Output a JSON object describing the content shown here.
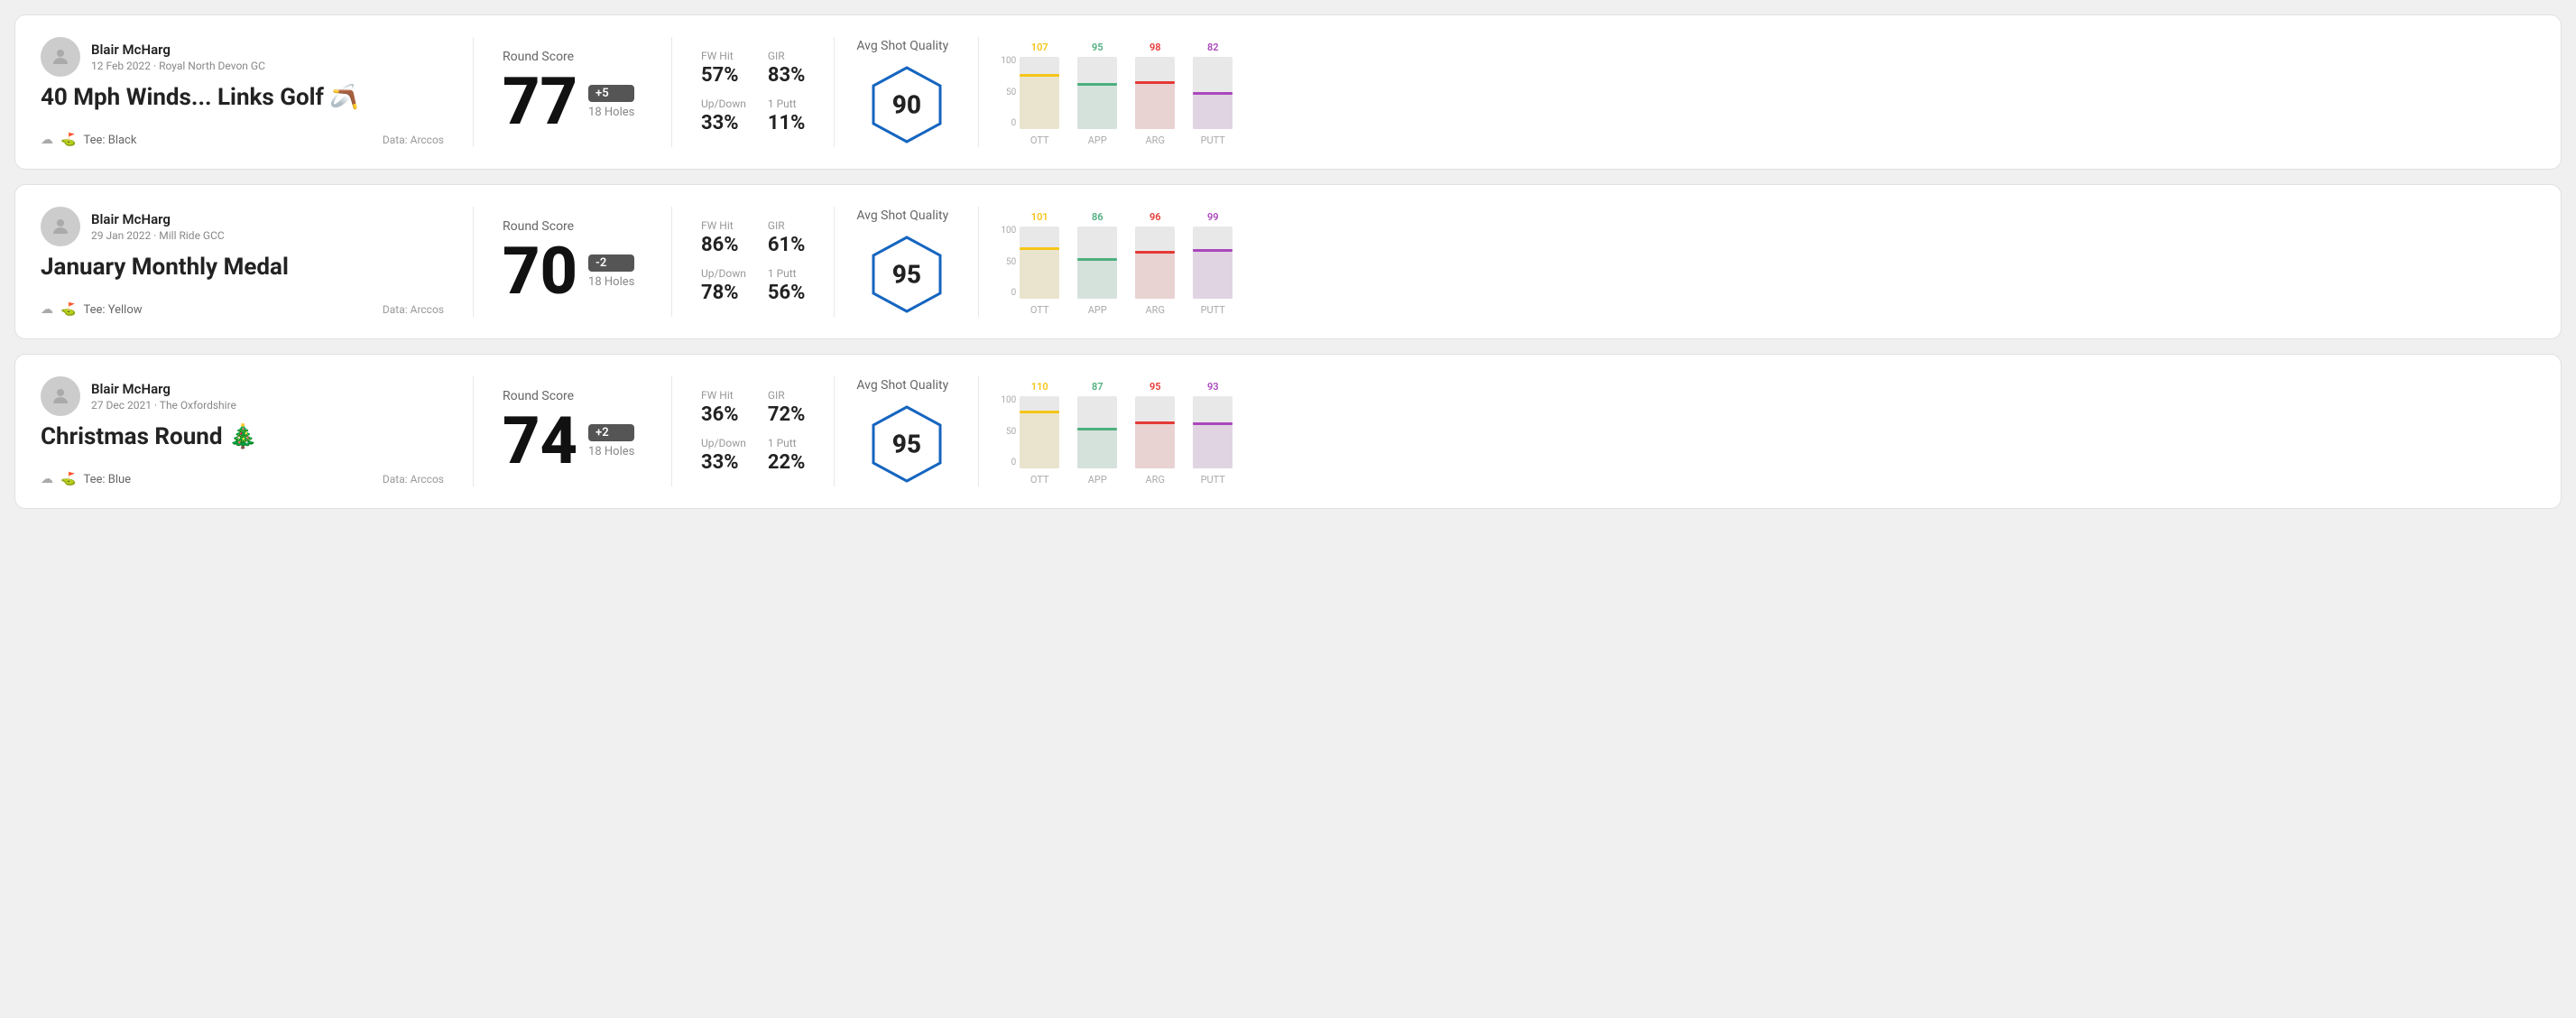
{
  "rounds": [
    {
      "id": "round1",
      "user": {
        "name": "Blair McHarg",
        "date": "12 Feb 2022 · Royal North Devon GC"
      },
      "title": "40 Mph Winds... Links Golf 🪃",
      "tee": "Black",
      "data_source": "Data: Arccos",
      "score": {
        "label": "Round Score",
        "number": "77",
        "badge": "+5",
        "holes": "18 Holes"
      },
      "stats": [
        {
          "name": "FW Hit",
          "value": "57%"
        },
        {
          "name": "GIR",
          "value": "83%"
        },
        {
          "name": "Up/Down",
          "value": "33%"
        },
        {
          "name": "1 Putt",
          "value": "11%"
        }
      ],
      "quality": {
        "label": "Avg Shot Quality",
        "score": "90"
      },
      "chart": {
        "bars": [
          {
            "label": "OTT",
            "value": 107,
            "color": "#f5c518",
            "height_pct": 72
          },
          {
            "label": "APP",
            "value": 95,
            "color": "#4caf7d",
            "height_pct": 60
          },
          {
            "label": "ARG",
            "value": 98,
            "color": "#e53935",
            "height_pct": 63
          },
          {
            "label": "PUTT",
            "value": 82,
            "color": "#ab47bc",
            "height_pct": 48
          }
        ]
      }
    },
    {
      "id": "round2",
      "user": {
        "name": "Blair McHarg",
        "date": "29 Jan 2022 · Mill Ride GCC"
      },
      "title": "January Monthly Medal",
      "tee": "Yellow",
      "data_source": "Data: Arccos",
      "score": {
        "label": "Round Score",
        "number": "70",
        "badge": "-2",
        "holes": "18 Holes"
      },
      "stats": [
        {
          "name": "FW Hit",
          "value": "86%"
        },
        {
          "name": "GIR",
          "value": "61%"
        },
        {
          "name": "Up/Down",
          "value": "78%"
        },
        {
          "name": "1 Putt",
          "value": "56%"
        }
      ],
      "quality": {
        "label": "Avg Shot Quality",
        "score": "95"
      },
      "chart": {
        "bars": [
          {
            "label": "OTT",
            "value": 101,
            "color": "#f5c518",
            "height_pct": 68
          },
          {
            "label": "APP",
            "value": 86,
            "color": "#4caf7d",
            "height_pct": 52
          },
          {
            "label": "ARG",
            "value": 96,
            "color": "#e53935",
            "height_pct": 62
          },
          {
            "label": "PUTT",
            "value": 99,
            "color": "#ab47bc",
            "height_pct": 65
          }
        ]
      }
    },
    {
      "id": "round3",
      "user": {
        "name": "Blair McHarg",
        "date": "27 Dec 2021 · The Oxfordshire"
      },
      "title": "Christmas Round 🎄",
      "tee": "Blue",
      "data_source": "Data: Arccos",
      "score": {
        "label": "Round Score",
        "number": "74",
        "badge": "+2",
        "holes": "18 Holes"
      },
      "stats": [
        {
          "name": "FW Hit",
          "value": "36%"
        },
        {
          "name": "GIR",
          "value": "72%"
        },
        {
          "name": "Up/Down",
          "value": "33%"
        },
        {
          "name": "1 Putt",
          "value": "22%"
        }
      ],
      "quality": {
        "label": "Avg Shot Quality",
        "score": "95"
      },
      "chart": {
        "bars": [
          {
            "label": "OTT",
            "value": 110,
            "color": "#f5c518",
            "height_pct": 76
          },
          {
            "label": "APP",
            "value": 87,
            "color": "#4caf7d",
            "height_pct": 53
          },
          {
            "label": "ARG",
            "value": 95,
            "color": "#e53935",
            "height_pct": 61
          },
          {
            "label": "PUTT",
            "value": 93,
            "color": "#ab47bc",
            "height_pct": 60
          }
        ]
      }
    }
  ],
  "y_axis_labels": [
    "100",
    "50",
    "0"
  ]
}
